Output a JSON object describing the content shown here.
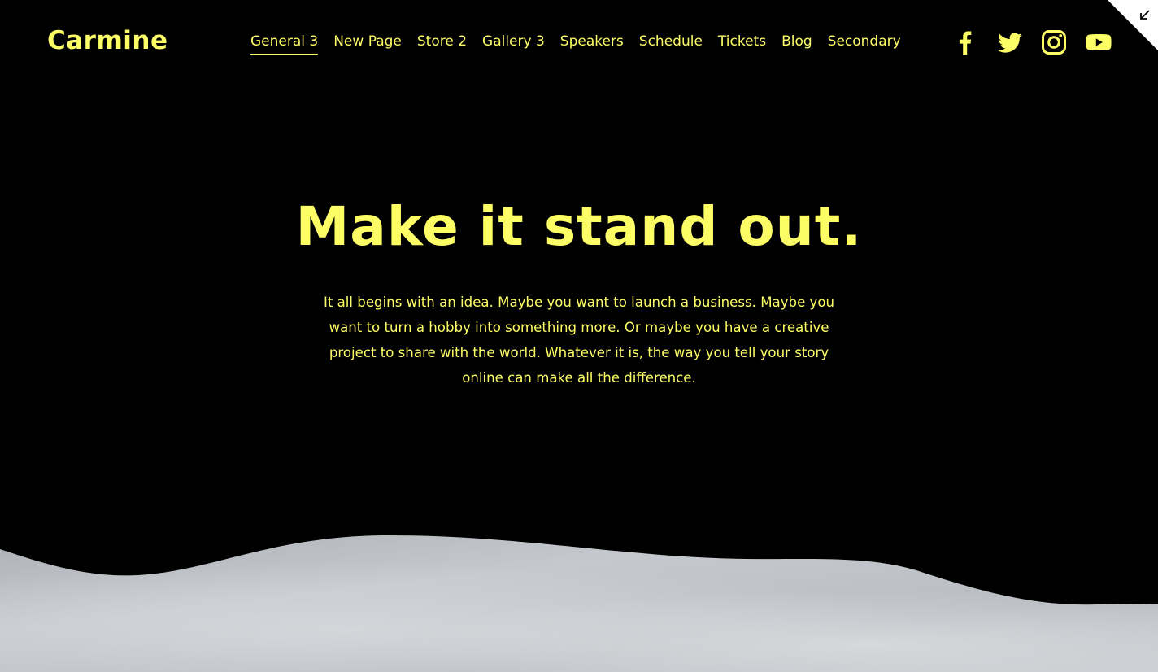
{
  "site": {
    "logo": "Carmine"
  },
  "nav": {
    "items": [
      {
        "label": "General 3",
        "active": true
      },
      {
        "label": "New Page",
        "active": false
      },
      {
        "label": "Store 2",
        "active": false
      },
      {
        "label": "Gallery 3",
        "active": false
      },
      {
        "label": "Speakers",
        "active": false
      },
      {
        "label": "Schedule",
        "active": false
      },
      {
        "label": "Tickets",
        "active": false
      },
      {
        "label": "Blog",
        "active": false
      },
      {
        "label": "Secondary",
        "active": false
      }
    ]
  },
  "social": [
    "facebook-icon",
    "twitter-icon",
    "instagram-icon",
    "youtube-icon"
  ],
  "hero": {
    "title": "Make it stand out.",
    "body": "It all begins with an idea. Maybe you want to launch a business. Maybe you want to turn a hobby into something more. Or maybe you have a creative project to share with the world. Whatever it is, the way you tell your story online can make all the difference."
  },
  "colors": {
    "background": "#000000",
    "accent": "#fdfd66",
    "corner": "#ffffff",
    "image_tone": "#c4c8cd"
  }
}
